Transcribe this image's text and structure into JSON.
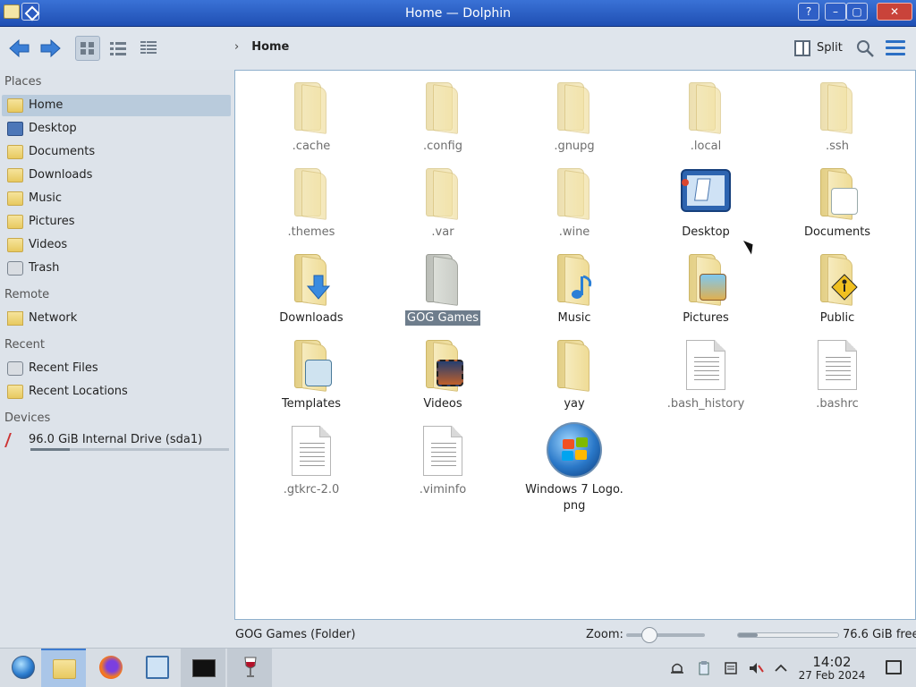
{
  "window": {
    "title": "Home — Dolphin",
    "controls": [
      "?",
      "–",
      "▢",
      "✕"
    ]
  },
  "toolbar": {
    "breadcrumb": "Home",
    "split_label": "Split"
  },
  "sidebar": {
    "sections": {
      "places": "Places",
      "remote": "Remote",
      "recent": "Recent",
      "devices": "Devices"
    },
    "places": [
      {
        "label": "Home",
        "icon": "home-folder-icon"
      },
      {
        "label": "Desktop",
        "icon": "desktop-icon"
      },
      {
        "label": "Documents",
        "icon": "documents-folder-icon"
      },
      {
        "label": "Downloads",
        "icon": "downloads-folder-icon"
      },
      {
        "label": "Music",
        "icon": "music-folder-icon"
      },
      {
        "label": "Pictures",
        "icon": "pictures-folder-icon"
      },
      {
        "label": "Videos",
        "icon": "videos-folder-icon"
      },
      {
        "label": "Trash",
        "icon": "trash-icon"
      }
    ],
    "remote": [
      {
        "label": "Network",
        "icon": "network-folder-icon"
      }
    ],
    "recent": [
      {
        "label": "Recent Files",
        "icon": "recent-files-icon"
      },
      {
        "label": "Recent Locations",
        "icon": "recent-locations-icon"
      }
    ],
    "devices": [
      {
        "label": "96.0 GiB Internal Drive (sda1)",
        "icon": "drive-icon",
        "used_fraction": 0.2
      }
    ]
  },
  "files": [
    {
      "name": ".cache",
      "kind": "folder",
      "hidden": true
    },
    {
      "name": ".config",
      "kind": "folder",
      "hidden": true
    },
    {
      "name": ".gnupg",
      "kind": "folder",
      "hidden": true
    },
    {
      "name": ".local",
      "kind": "folder",
      "hidden": true
    },
    {
      "name": ".ssh",
      "kind": "folder",
      "hidden": true
    },
    {
      "name": ".themes",
      "kind": "folder",
      "hidden": true
    },
    {
      "name": ".var",
      "kind": "folder",
      "hidden": true
    },
    {
      "name": ".wine",
      "kind": "folder",
      "hidden": true
    },
    {
      "name": "Desktop",
      "kind": "desktop",
      "hidden": false
    },
    {
      "name": "Documents",
      "kind": "folder-documents",
      "hidden": false
    },
    {
      "name": "Downloads",
      "kind": "folder-downloads",
      "hidden": false
    },
    {
      "name": "GOG Games",
      "kind": "folder-gog",
      "hidden": false,
      "selected": true
    },
    {
      "name": "Music",
      "kind": "folder-music",
      "hidden": false
    },
    {
      "name": "Pictures",
      "kind": "folder-pictures",
      "hidden": false
    },
    {
      "name": "Public",
      "kind": "folder-public",
      "hidden": false
    },
    {
      "name": "Templates",
      "kind": "folder-templates",
      "hidden": false
    },
    {
      "name": "Videos",
      "kind": "folder-videos",
      "hidden": false
    },
    {
      "name": "yay",
      "kind": "folder",
      "hidden": false
    },
    {
      "name": ".bash_history",
      "kind": "text",
      "hidden": true
    },
    {
      "name": ".bashrc",
      "kind": "text",
      "hidden": true
    },
    {
      "name": ".gtkrc-2.0",
      "kind": "text",
      "hidden": true
    },
    {
      "name": ".viminfo",
      "kind": "text",
      "hidden": true
    },
    {
      "name": "Windows 7 Logo.\npng",
      "kind": "image-windows-logo",
      "hidden": false
    }
  ],
  "statusbar": {
    "status": "GOG Games (Folder)",
    "zoom_label": "Zoom:",
    "zoom_fraction": 0.3,
    "free_fraction": 0.2,
    "free_text": "76.6 GiB free"
  },
  "taskbar": {
    "apps": [
      {
        "name": "start-menu-icon"
      },
      {
        "name": "dolphin-file-manager-icon",
        "active": true
      },
      {
        "name": "firefox-icon"
      },
      {
        "name": "system-settings-icon"
      },
      {
        "name": "terminal-icon",
        "running": true
      },
      {
        "name": "wine-glass-icon",
        "running": true
      }
    ],
    "time": "14:02",
    "date": "27 Feb 2024"
  },
  "colors": {
    "selection": "#b9cbdc",
    "accent": "#2b6fc4",
    "titlebar": "#2a5fc7"
  }
}
